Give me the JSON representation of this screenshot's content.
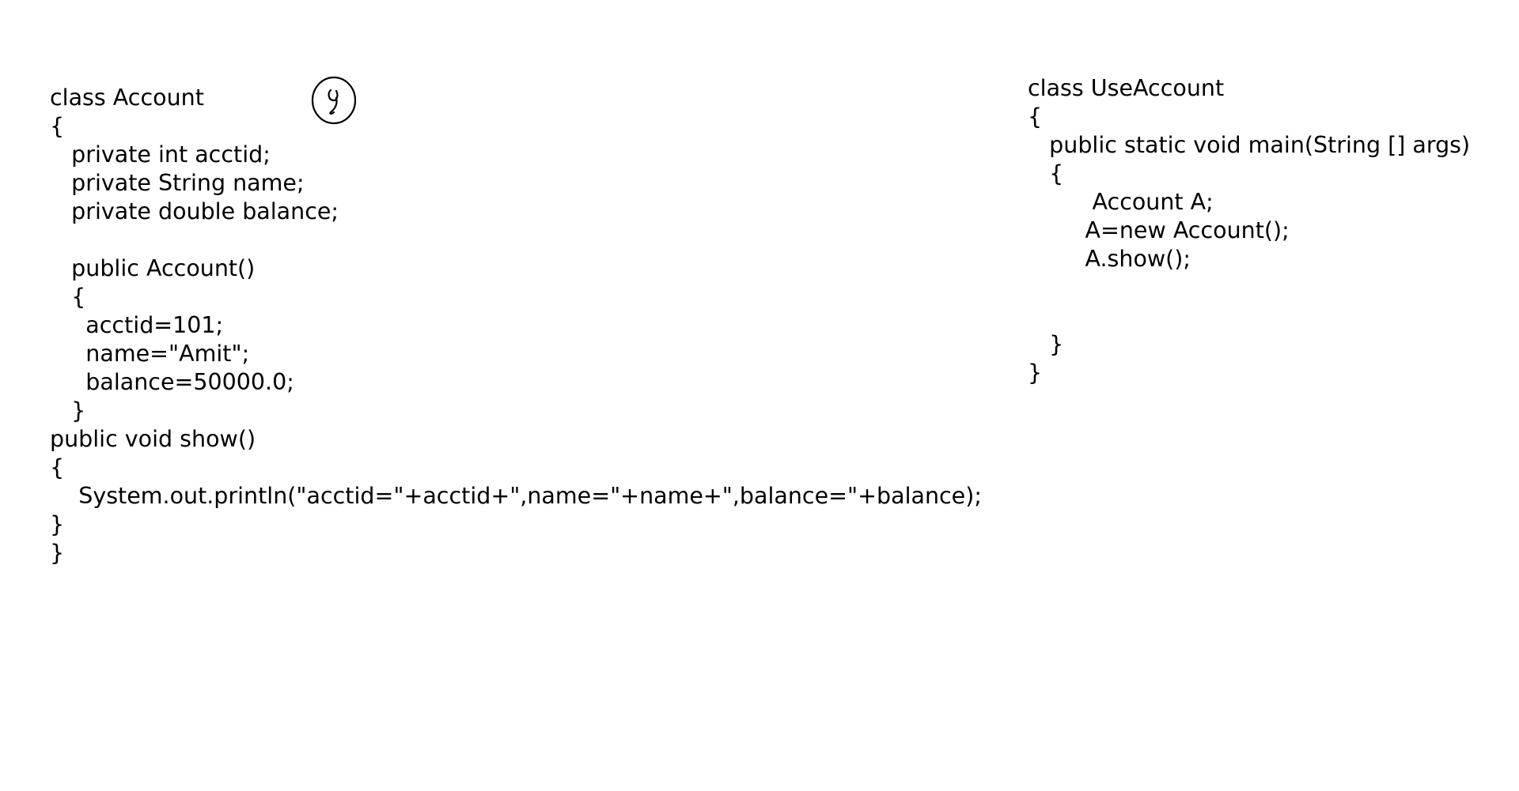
{
  "account_class": {
    "lines": [
      "class Account",
      "{",
      "   private int acctid;",
      "   private String name;",
      "   private double balance;",
      "",
      "   public Account()",
      "   {",
      "     acctid=101;",
      "     name=\"Amit\";",
      "     balance=50000.0;",
      "   }",
      "public void show()",
      "{",
      "    System.out.println(\"acctid=\"+acctid+\",name=\"+name+\",balance=\"+balance);",
      "}",
      "}"
    ]
  },
  "use_account_class": {
    "lines": [
      "class UseAccount",
      "{",
      "   public static void main(String [] args)",
      "   {",
      "         Account A;",
      "        A=new Account();",
      "        A.show();",
      "",
      "",
      "   }",
      "}"
    ]
  }
}
